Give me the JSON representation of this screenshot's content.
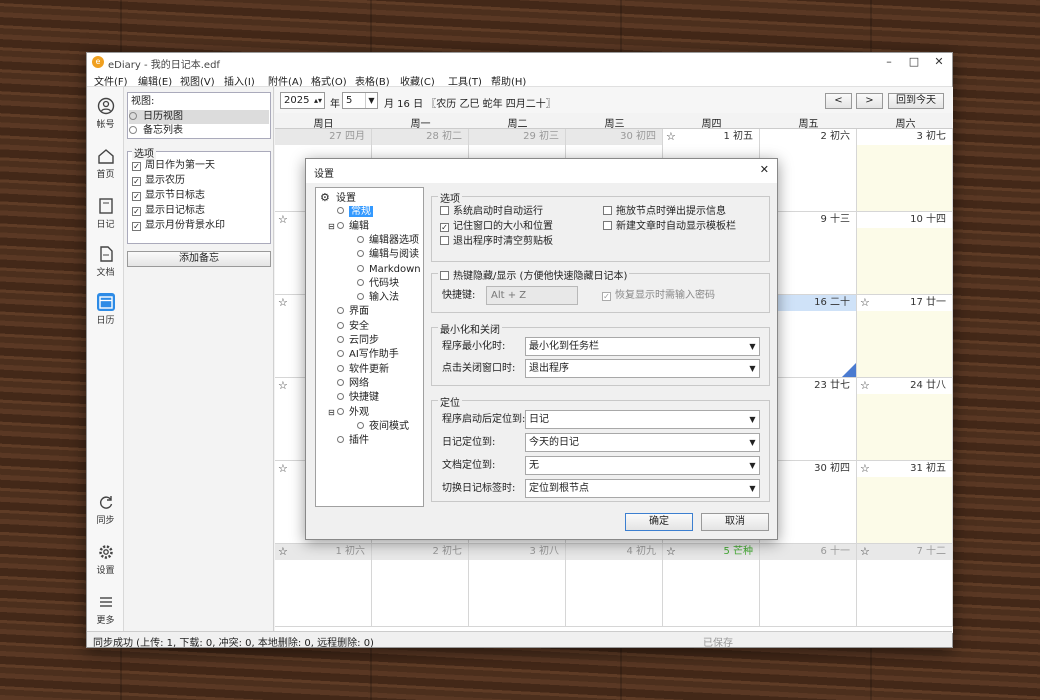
{
  "window": {
    "title": "eDiary - 我的日记本.edf",
    "logo_glyph": "e",
    "minimize": "–",
    "maximize": "□",
    "close": "✕"
  },
  "menu": [
    "文件(F)",
    "编辑(E)",
    "视图(V)",
    "插入(I)",
    "附件(A)",
    "格式(O)",
    "表格(B)",
    "收藏(C)",
    "工具(T)",
    "帮助(H)"
  ],
  "sidebar": [
    {
      "label": "帐号",
      "icon": "account-icon"
    },
    {
      "label": "首页",
      "icon": "home-icon"
    },
    {
      "label": "日记",
      "icon": "diary-icon"
    },
    {
      "label": "文档",
      "icon": "document-icon"
    },
    {
      "label": "日历",
      "icon": "calendar-icon",
      "active": true
    },
    {
      "label": "同步",
      "icon": "sync-icon"
    },
    {
      "label": "设置",
      "icon": "settings-icon"
    },
    {
      "label": "更多",
      "icon": "menu-icon"
    }
  ],
  "view_panel": {
    "title": "视图:",
    "items": [
      "日历视图",
      "备忘列表"
    ]
  },
  "options_panel": {
    "title": "选项",
    "items": [
      "周日作为第一天",
      "显示农历",
      "显示节日标志",
      "显示日记标志",
      "显示月份背景水印"
    ]
  },
  "add_memo_label": "添加备忘",
  "nav": {
    "year": "2025",
    "year_unit": "年",
    "month": "5",
    "date_text": "月 16 日 〖农历 乙巳 蛇年 四月二十〗",
    "prev": "<",
    "next": ">",
    "today": "回到今天"
  },
  "weekdays": [
    "周日",
    "周一",
    "周二",
    "周三",
    "周四",
    "周五",
    "周六"
  ],
  "calendar_rows": [
    [
      {
        "d": "27 四月",
        "dim": true
      },
      {
        "d": "28 初二",
        "dim": true
      },
      {
        "d": "29 初三",
        "dim": true
      },
      {
        "d": "30 初四",
        "dim": true
      },
      {
        "d": "1 初五",
        "star": true
      },
      {
        "d": "2 初六"
      },
      {
        "d": "3 初七",
        "we": true
      }
    ],
    [
      {
        "d": "",
        "star": true
      },
      null,
      null,
      null,
      null,
      {
        "d": "9 十三"
      },
      {
        "d": "10 十四",
        "we": true
      }
    ],
    [
      {
        "d": "",
        "star": true
      },
      null,
      null,
      null,
      null,
      {
        "d": "16 二十",
        "today": true
      },
      {
        "d": "17 廿一",
        "star": true,
        "we": true
      }
    ],
    [
      {
        "d": "",
        "star": true
      },
      null,
      null,
      null,
      null,
      {
        "d": "23 廿七"
      },
      {
        "d": "24 廿八",
        "star": true,
        "we": true
      }
    ],
    [
      {
        "d": "",
        "star": true
      },
      null,
      null,
      null,
      null,
      {
        "d": "30 初四"
      },
      {
        "d": "31 初五",
        "star": true,
        "we": true
      }
    ],
    [
      {
        "d": "1 初六",
        "star": true,
        "dim": true
      },
      {
        "d": "2 初七",
        "dim": true
      },
      {
        "d": "3 初八",
        "dim": true
      },
      {
        "d": "4 初九",
        "dim": true
      },
      {
        "d": "5 芒种",
        "star": true,
        "dim": true,
        "green": true
      },
      {
        "d": "6 十一",
        "dim": true
      },
      {
        "d": "7 十二",
        "dim": true,
        "star": true
      }
    ]
  ],
  "status": {
    "left": "同步成功 (上传: 1, 下载: 0, 冲突: 0, 本地删除: 0, 远程删除: 0)",
    "saved": "已保存"
  },
  "dialog": {
    "title": "设置",
    "close": "✕",
    "tree": [
      {
        "label": "设置",
        "level": 0,
        "type": "root"
      },
      {
        "label": "常规",
        "level": 1,
        "selected": true
      },
      {
        "label": "编辑",
        "level": 1,
        "expand": true
      },
      {
        "label": "编辑器选项",
        "level": 2
      },
      {
        "label": "编辑与阅读",
        "level": 2
      },
      {
        "label": "Markdown",
        "level": 2
      },
      {
        "label": "代码块",
        "level": 2
      },
      {
        "label": "输入法",
        "level": 2
      },
      {
        "label": "界面",
        "level": 1
      },
      {
        "label": "安全",
        "level": 1
      },
      {
        "label": "云同步",
        "level": 1
      },
      {
        "label": "AI写作助手",
        "level": 1
      },
      {
        "label": "软件更新",
        "level": 1
      },
      {
        "label": "网络",
        "level": 1
      },
      {
        "label": "快捷键",
        "level": 1
      },
      {
        "label": "外观",
        "level": 1,
        "expand": true
      },
      {
        "label": "夜间模式",
        "level": 2
      },
      {
        "label": "插件",
        "level": 1
      }
    ],
    "options": {
      "title": "选项",
      "items": [
        {
          "label": "系统启动时自动运行",
          "checked": false
        },
        {
          "label": "拖放节点时弹出提示信息",
          "checked": false
        },
        {
          "label": "记住窗口的大小和位置",
          "checked": true
        },
        {
          "label": "新建文章时自动显示模板栏",
          "checked": false
        },
        {
          "label": "退出程序时清空剪贴板",
          "checked": false
        }
      ]
    },
    "hotkey": {
      "title": "热键隐藏/显示 (方便他快速隐藏日记本)",
      "shortcut_label": "快捷键:",
      "shortcut_value": "Alt + Z",
      "restore_label": "恢复显示时需输入密码"
    },
    "minimize": {
      "title": "最小化和关闭",
      "rows": [
        {
          "label": "程序最小化时:",
          "value": "最小化到任务栏"
        },
        {
          "label": "点击关闭窗口时:",
          "value": "退出程序"
        }
      ]
    },
    "locate": {
      "title": "定位",
      "rows": [
        {
          "label": "程序启动后定位到:",
          "value": "日记"
        },
        {
          "label": "日记定位到:",
          "value": "今天的日记"
        },
        {
          "label": "文档定位到:",
          "value": "无"
        },
        {
          "label": "切换日记标签时:",
          "value": "定位到根节点"
        }
      ]
    },
    "ok": "确定",
    "cancel": "取消"
  },
  "colors": {
    "accent": "#2d8be6",
    "weekend_bg": "#fcfbe8",
    "today_bg": "#cfe2f8",
    "select": "#3399ff"
  }
}
